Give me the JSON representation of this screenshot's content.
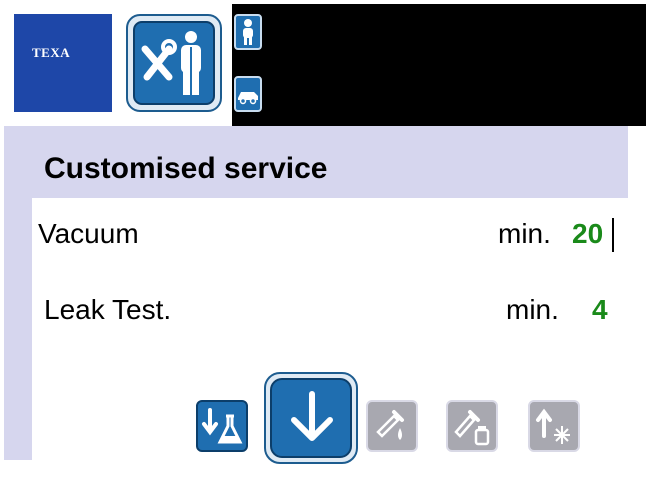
{
  "brand": {
    "logo_text": "TEXA",
    "color": "#1e47a8"
  },
  "header": {
    "mode_icon": "tools-technician-icon",
    "side_buttons": [
      {
        "icon": "person-icon"
      },
      {
        "icon": "car-icon"
      }
    ]
  },
  "main": {
    "title": "Customised service",
    "rows": [
      {
        "label": "Vacuum",
        "unit": "min.",
        "value": "20"
      },
      {
        "label": "Leak Test.",
        "unit": "min.",
        "value": "4"
      }
    ]
  },
  "toolbar": {
    "buttons": [
      {
        "icon": "download-flask-icon",
        "state": "enabled"
      },
      {
        "icon": "arrow-down-icon",
        "state": "selected"
      },
      {
        "icon": "oil-dropper-icon",
        "state": "disabled"
      },
      {
        "icon": "dropper-bottle-icon",
        "state": "disabled"
      },
      {
        "icon": "up-arrow-snowflake-icon",
        "state": "disabled"
      }
    ]
  },
  "colors": {
    "accent_blue": "#1f6eb0",
    "value_green": "#1a8a1a",
    "content_background": "#d6d6ee"
  }
}
